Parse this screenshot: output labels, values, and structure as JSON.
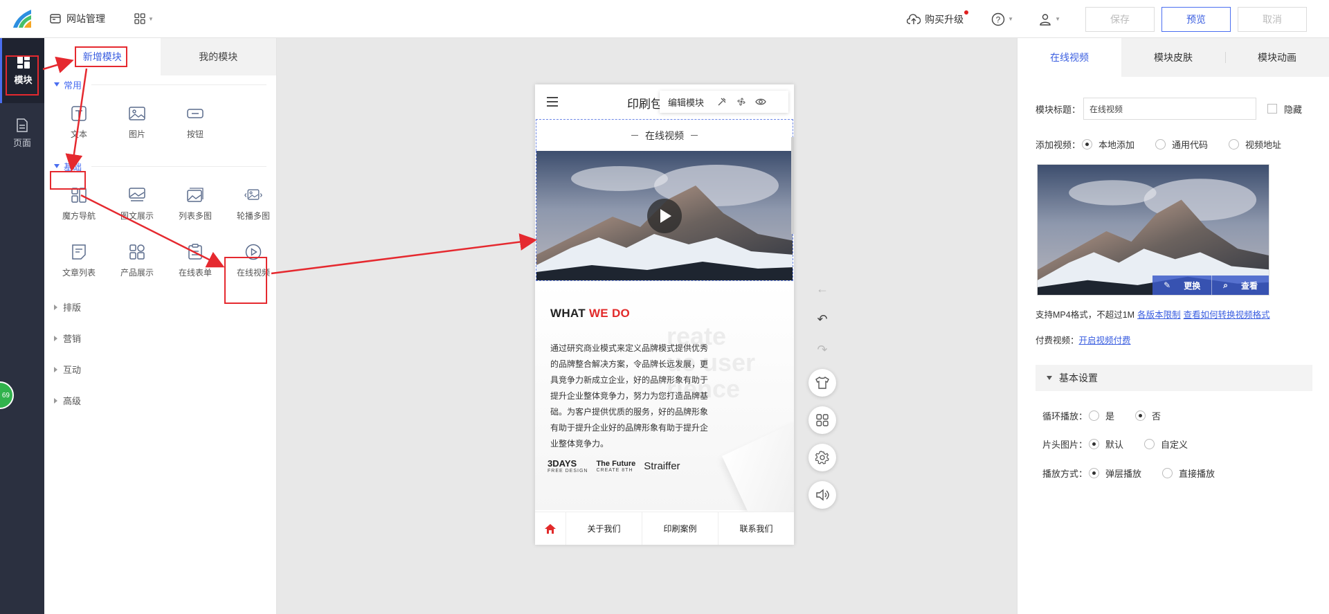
{
  "topbar": {
    "site_mgmt": "网站管理",
    "buy": "购买升级",
    "save": "保存",
    "preview": "预览",
    "cancel": "取消"
  },
  "rail": {
    "module": "模块",
    "page": "页面"
  },
  "modpanel": {
    "tab_new": "新增模块",
    "tab_mine": "我的模块",
    "common_title": "常用",
    "common_items": [
      "文本",
      "图片",
      "按钮"
    ],
    "basic_title": "基础",
    "basic_items": [
      "魔方导航",
      "图文展示",
      "列表多图",
      "轮播多图",
      "文章列表",
      "产品展示",
      "在线表单",
      "在线视频"
    ],
    "layout": "排版",
    "marketing": "营销",
    "interaction": "互动",
    "advanced": "高级",
    "badge": "69"
  },
  "phone": {
    "title": "印刷包",
    "edit_module": "编辑模块",
    "video_title": "在线视频",
    "what": "WHAT",
    "we_do": "WE DO",
    "bg_text": [
      "reate",
      "ue user",
      "rience"
    ],
    "body": "通过研究商业模式来定义品牌模式提供优秀的品牌整合解决方案，令品牌长远发展，更具竞争力新成立企业，好的品牌形象有助于提升企业整体竞争力，努力为您打造品牌基础。为客户提供优质的服务，好的品牌形象有助于提升企业好的品牌形象有助于提升企业整体竞争力。",
    "brand1": "3DAYS",
    "brand1_sub": "FREE DESIGN",
    "brand2": "The Future",
    "brand2_sub": "CREATE 8TH",
    "brand3": "Straiffer",
    "nav": [
      "关于我们",
      "印刷案例",
      "联系我们"
    ]
  },
  "rpanel": {
    "tab_video": "在线视频",
    "tab_skin": "模块皮肤",
    "tab_anim": "模块动画",
    "title_label": "模块标题：",
    "title_value": "在线视频",
    "hide": "隐藏",
    "add_video_label": "添加视频：",
    "add_options": [
      "本地添加",
      "通用代码",
      "视频地址"
    ],
    "replace": "更换",
    "view": "查看",
    "support_text": "支持MP4格式，不超过1M",
    "version_limit": "各版本限制",
    "convert_link": "查看如何转换视频格式",
    "paid_label": "付费视频：",
    "paid_link": "开启视频付费",
    "basic_settings": "基本设置",
    "loop_label": "循环播放：",
    "loop_options": [
      "是",
      "否"
    ],
    "cover_label": "片头图片：",
    "cover_options": [
      "默认",
      "自定义"
    ],
    "mode_label": "播放方式：",
    "mode_options": [
      "弹层播放",
      "直接播放"
    ]
  },
  "colors": {
    "accent": "#3a5ee0",
    "rail": "#2b3040",
    "annotation": "#e5292f"
  }
}
